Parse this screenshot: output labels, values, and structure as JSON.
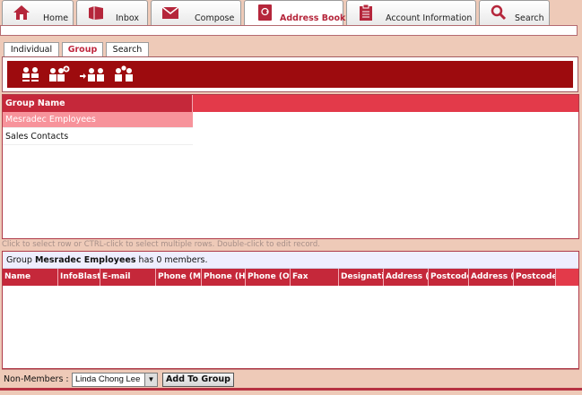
{
  "nav": {
    "tabs": [
      {
        "label": "Home",
        "icon": "home-icon"
      },
      {
        "label": "Inbox",
        "icon": "inbox-icon"
      },
      {
        "label": "Compose",
        "icon": "compose-icon"
      },
      {
        "label": "Address Book",
        "icon": "address-book-icon",
        "active": true
      },
      {
        "label": "Account Information",
        "icon": "account-info-icon"
      },
      {
        "label": "Search",
        "icon": "search-icon"
      }
    ]
  },
  "subtabs": [
    {
      "label": "Individual"
    },
    {
      "label": "Group",
      "active": true
    },
    {
      "label": "Search"
    }
  ],
  "toolbar": {
    "buttons": [
      "group-icon",
      "add-group-icon",
      "move-to-group-icon",
      "group-members-icon"
    ]
  },
  "groups": {
    "header": "Group Name",
    "rows": [
      {
        "name": "Mesradec Employees",
        "selected": true
      },
      {
        "name": "Sales Contacts",
        "selected": false
      }
    ]
  },
  "hint": "Click to select row or CTRL-click to select multiple rows. Double-click to edit record.",
  "members": {
    "prefix": "Group",
    "group_name": "Mesradec Employees",
    "suffix": "has 0 members.",
    "columns": [
      "Name",
      "InfoBlast",
      "E-mail",
      "Phone (Mobile)",
      "Phone (Home)",
      "Phone (Office)",
      "Fax",
      "Designation",
      "Address (Home)",
      "Postcode",
      "Address (Office)",
      "Postcode"
    ]
  },
  "bottom": {
    "label": "Non-Members :",
    "selected": "Linda Chong Lee",
    "add_button": "Add To Group"
  },
  "colors": {
    "accent": "#c5283a",
    "toolbar": "#9d0b0e",
    "selected_row": "#f7939b",
    "page_bg": "#eecab8"
  }
}
